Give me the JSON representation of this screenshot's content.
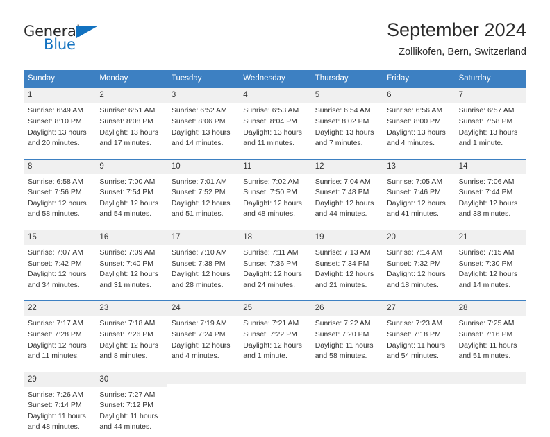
{
  "logo": {
    "word_one": "General",
    "word_two": "Blue",
    "triangle_icon": "triangle-icon",
    "brand_color": "#1272c0",
    "text_color": "#2b2b2b"
  },
  "header": {
    "title": "September 2024",
    "subtitle": "Zollikofen, Bern, Switzerland"
  },
  "calendar": {
    "header_bg": "#3d80c2",
    "daynum_bg": "#f0f0f0",
    "weekdays": [
      "Sunday",
      "Monday",
      "Tuesday",
      "Wednesday",
      "Thursday",
      "Friday",
      "Saturday"
    ],
    "weeks": [
      [
        {
          "day": "1",
          "sunrise": "Sunrise: 6:49 AM",
          "sunset": "Sunset: 8:10 PM",
          "daylight1": "Daylight: 13 hours",
          "daylight2": "and 20 minutes."
        },
        {
          "day": "2",
          "sunrise": "Sunrise: 6:51 AM",
          "sunset": "Sunset: 8:08 PM",
          "daylight1": "Daylight: 13 hours",
          "daylight2": "and 17 minutes."
        },
        {
          "day": "3",
          "sunrise": "Sunrise: 6:52 AM",
          "sunset": "Sunset: 8:06 PM",
          "daylight1": "Daylight: 13 hours",
          "daylight2": "and 14 minutes."
        },
        {
          "day": "4",
          "sunrise": "Sunrise: 6:53 AM",
          "sunset": "Sunset: 8:04 PM",
          "daylight1": "Daylight: 13 hours",
          "daylight2": "and 11 minutes."
        },
        {
          "day": "5",
          "sunrise": "Sunrise: 6:54 AM",
          "sunset": "Sunset: 8:02 PM",
          "daylight1": "Daylight: 13 hours",
          "daylight2": "and 7 minutes."
        },
        {
          "day": "6",
          "sunrise": "Sunrise: 6:56 AM",
          "sunset": "Sunset: 8:00 PM",
          "daylight1": "Daylight: 13 hours",
          "daylight2": "and 4 minutes."
        },
        {
          "day": "7",
          "sunrise": "Sunrise: 6:57 AM",
          "sunset": "Sunset: 7:58 PM",
          "daylight1": "Daylight: 13 hours",
          "daylight2": "and 1 minute."
        }
      ],
      [
        {
          "day": "8",
          "sunrise": "Sunrise: 6:58 AM",
          "sunset": "Sunset: 7:56 PM",
          "daylight1": "Daylight: 12 hours",
          "daylight2": "and 58 minutes."
        },
        {
          "day": "9",
          "sunrise": "Sunrise: 7:00 AM",
          "sunset": "Sunset: 7:54 PM",
          "daylight1": "Daylight: 12 hours",
          "daylight2": "and 54 minutes."
        },
        {
          "day": "10",
          "sunrise": "Sunrise: 7:01 AM",
          "sunset": "Sunset: 7:52 PM",
          "daylight1": "Daylight: 12 hours",
          "daylight2": "and 51 minutes."
        },
        {
          "day": "11",
          "sunrise": "Sunrise: 7:02 AM",
          "sunset": "Sunset: 7:50 PM",
          "daylight1": "Daylight: 12 hours",
          "daylight2": "and 48 minutes."
        },
        {
          "day": "12",
          "sunrise": "Sunrise: 7:04 AM",
          "sunset": "Sunset: 7:48 PM",
          "daylight1": "Daylight: 12 hours",
          "daylight2": "and 44 minutes."
        },
        {
          "day": "13",
          "sunrise": "Sunrise: 7:05 AM",
          "sunset": "Sunset: 7:46 PM",
          "daylight1": "Daylight: 12 hours",
          "daylight2": "and 41 minutes."
        },
        {
          "day": "14",
          "sunrise": "Sunrise: 7:06 AM",
          "sunset": "Sunset: 7:44 PM",
          "daylight1": "Daylight: 12 hours",
          "daylight2": "and 38 minutes."
        }
      ],
      [
        {
          "day": "15",
          "sunrise": "Sunrise: 7:07 AM",
          "sunset": "Sunset: 7:42 PM",
          "daylight1": "Daylight: 12 hours",
          "daylight2": "and 34 minutes."
        },
        {
          "day": "16",
          "sunrise": "Sunrise: 7:09 AM",
          "sunset": "Sunset: 7:40 PM",
          "daylight1": "Daylight: 12 hours",
          "daylight2": "and 31 minutes."
        },
        {
          "day": "17",
          "sunrise": "Sunrise: 7:10 AM",
          "sunset": "Sunset: 7:38 PM",
          "daylight1": "Daylight: 12 hours",
          "daylight2": "and 28 minutes."
        },
        {
          "day": "18",
          "sunrise": "Sunrise: 7:11 AM",
          "sunset": "Sunset: 7:36 PM",
          "daylight1": "Daylight: 12 hours",
          "daylight2": "and 24 minutes."
        },
        {
          "day": "19",
          "sunrise": "Sunrise: 7:13 AM",
          "sunset": "Sunset: 7:34 PM",
          "daylight1": "Daylight: 12 hours",
          "daylight2": "and 21 minutes."
        },
        {
          "day": "20",
          "sunrise": "Sunrise: 7:14 AM",
          "sunset": "Sunset: 7:32 PM",
          "daylight1": "Daylight: 12 hours",
          "daylight2": "and 18 minutes."
        },
        {
          "day": "21",
          "sunrise": "Sunrise: 7:15 AM",
          "sunset": "Sunset: 7:30 PM",
          "daylight1": "Daylight: 12 hours",
          "daylight2": "and 14 minutes."
        }
      ],
      [
        {
          "day": "22",
          "sunrise": "Sunrise: 7:17 AM",
          "sunset": "Sunset: 7:28 PM",
          "daylight1": "Daylight: 12 hours",
          "daylight2": "and 11 minutes."
        },
        {
          "day": "23",
          "sunrise": "Sunrise: 7:18 AM",
          "sunset": "Sunset: 7:26 PM",
          "daylight1": "Daylight: 12 hours",
          "daylight2": "and 8 minutes."
        },
        {
          "day": "24",
          "sunrise": "Sunrise: 7:19 AM",
          "sunset": "Sunset: 7:24 PM",
          "daylight1": "Daylight: 12 hours",
          "daylight2": "and 4 minutes."
        },
        {
          "day": "25",
          "sunrise": "Sunrise: 7:21 AM",
          "sunset": "Sunset: 7:22 PM",
          "daylight1": "Daylight: 12 hours",
          "daylight2": "and 1 minute."
        },
        {
          "day": "26",
          "sunrise": "Sunrise: 7:22 AM",
          "sunset": "Sunset: 7:20 PM",
          "daylight1": "Daylight: 11 hours",
          "daylight2": "and 58 minutes."
        },
        {
          "day": "27",
          "sunrise": "Sunrise: 7:23 AM",
          "sunset": "Sunset: 7:18 PM",
          "daylight1": "Daylight: 11 hours",
          "daylight2": "and 54 minutes."
        },
        {
          "day": "28",
          "sunrise": "Sunrise: 7:25 AM",
          "sunset": "Sunset: 7:16 PM",
          "daylight1": "Daylight: 11 hours",
          "daylight2": "and 51 minutes."
        }
      ],
      [
        {
          "day": "29",
          "sunrise": "Sunrise: 7:26 AM",
          "sunset": "Sunset: 7:14 PM",
          "daylight1": "Daylight: 11 hours",
          "daylight2": "and 48 minutes."
        },
        {
          "day": "30",
          "sunrise": "Sunrise: 7:27 AM",
          "sunset": "Sunset: 7:12 PM",
          "daylight1": "Daylight: 11 hours",
          "daylight2": "and 44 minutes."
        },
        {
          "day": "",
          "sunrise": "",
          "sunset": "",
          "daylight1": "",
          "daylight2": ""
        },
        {
          "day": "",
          "sunrise": "",
          "sunset": "",
          "daylight1": "",
          "daylight2": ""
        },
        {
          "day": "",
          "sunrise": "",
          "sunset": "",
          "daylight1": "",
          "daylight2": ""
        },
        {
          "day": "",
          "sunrise": "",
          "sunset": "",
          "daylight1": "",
          "daylight2": ""
        },
        {
          "day": "",
          "sunrise": "",
          "sunset": "",
          "daylight1": "",
          "daylight2": ""
        }
      ]
    ]
  }
}
